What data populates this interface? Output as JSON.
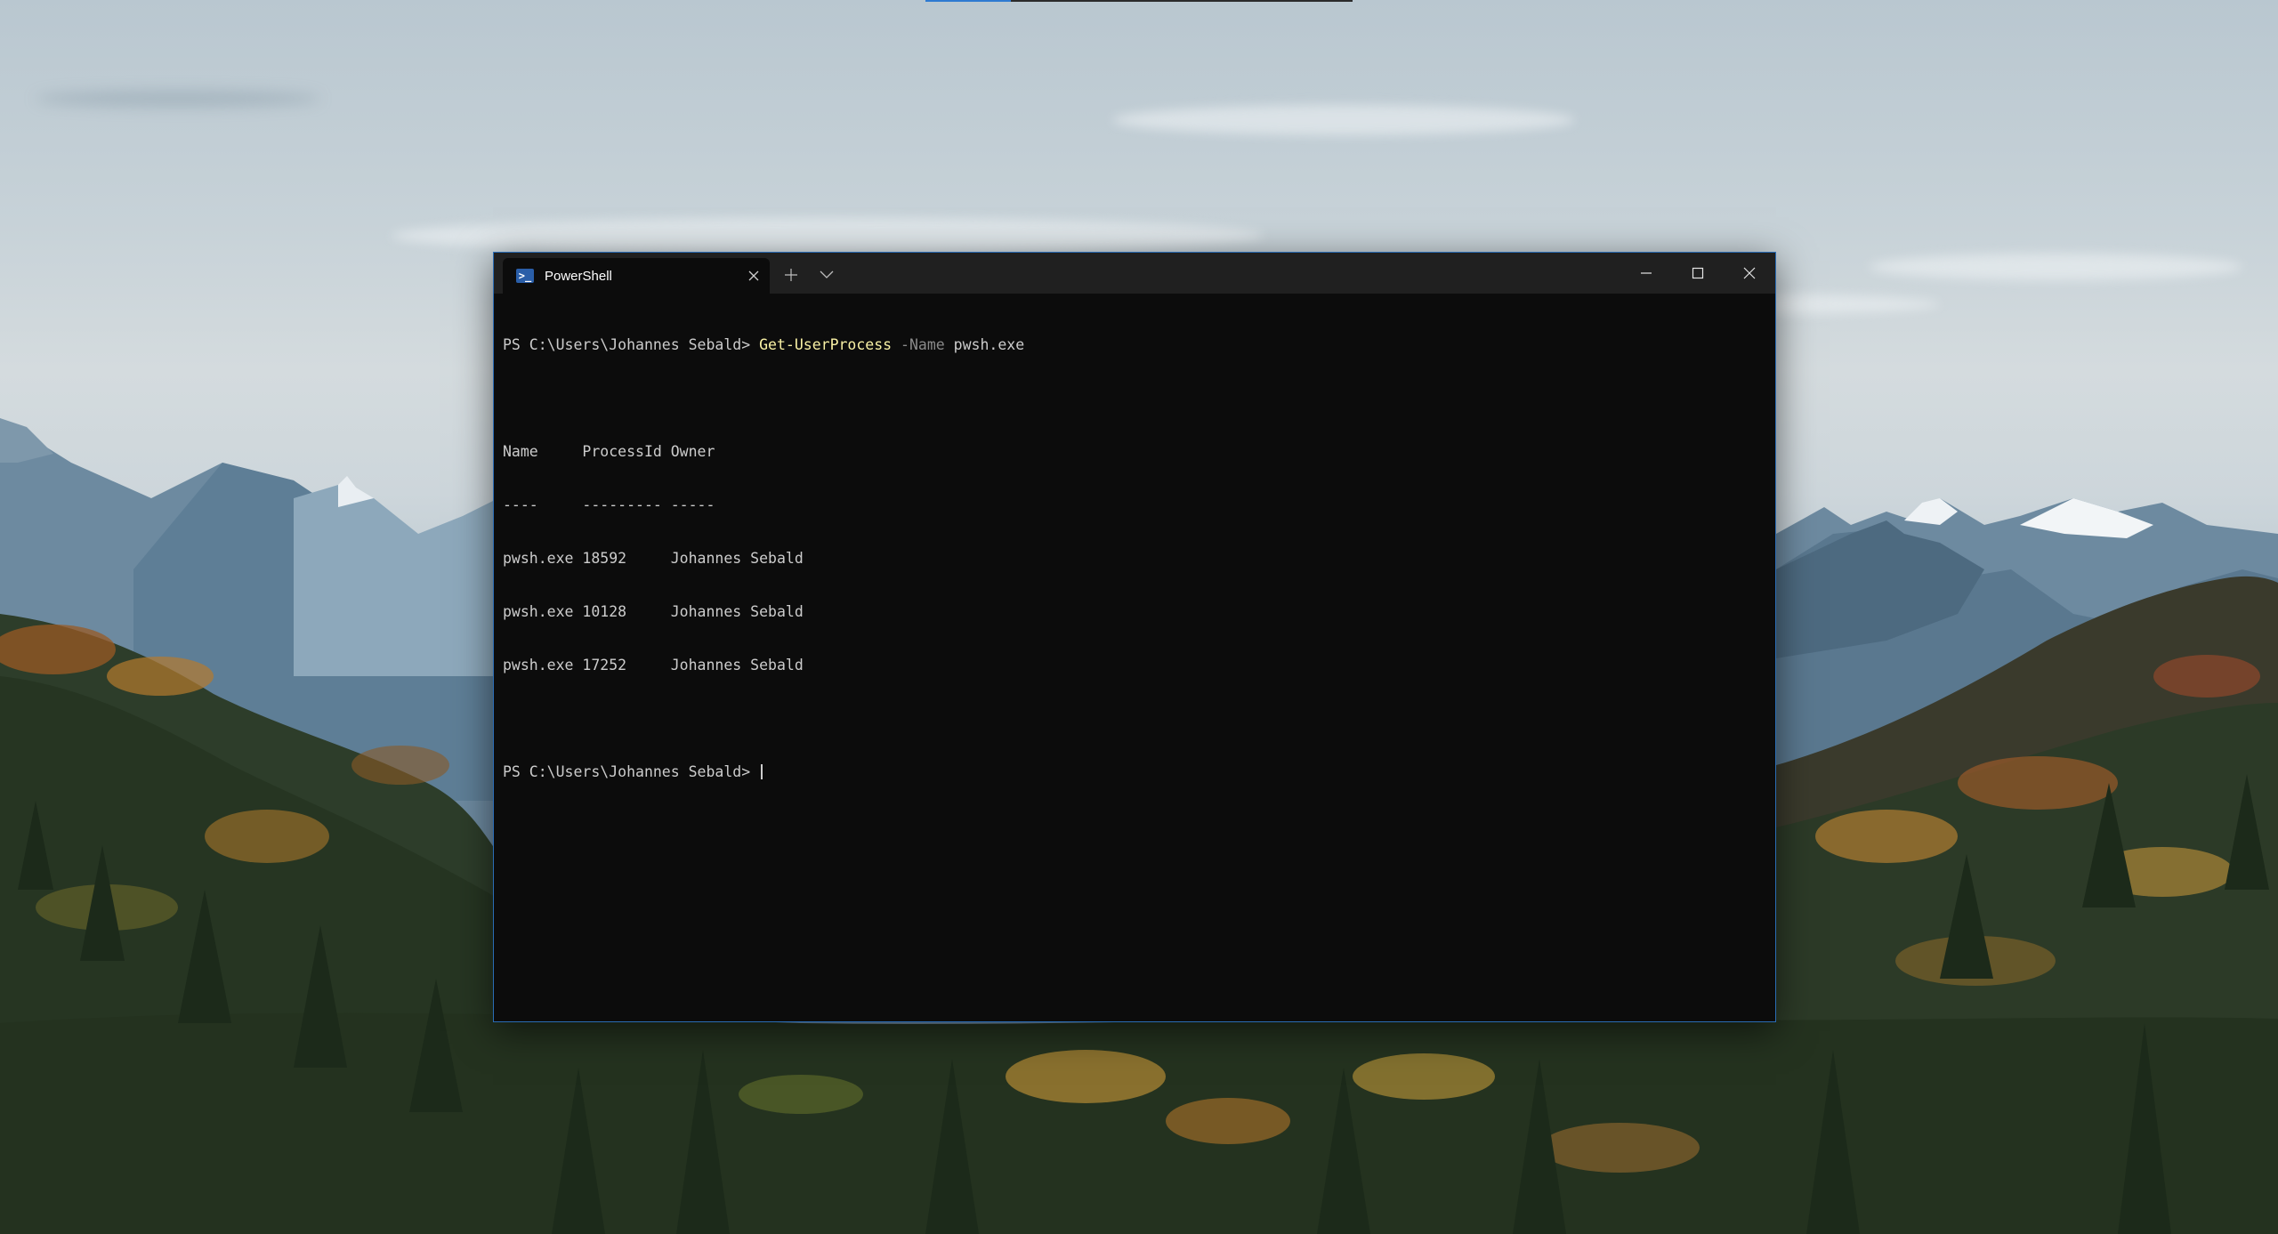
{
  "window": {
    "tab_title": "PowerShell",
    "tab_icon": "powershell-icon",
    "tab_icon_glyph": ">_",
    "accent_color": "#2a6cb5",
    "console_background": "#0c0c0c"
  },
  "console": {
    "prompt": "PS C:\\Users\\Johannes Sebald> ",
    "command_name": "Get-UserProcess",
    "command_param": "-Name",
    "command_value": "pwsh.exe",
    "table": {
      "header": "Name     ProcessId Owner",
      "separator": "----     --------- -----",
      "rows": [
        "pwsh.exe 18592     Johannes Sebald",
        "pwsh.exe 10128     Johannes Sebald",
        "pwsh.exe 17252     Johannes Sebald"
      ]
    },
    "prompt2": "PS C:\\Users\\Johannes Sebald> "
  }
}
